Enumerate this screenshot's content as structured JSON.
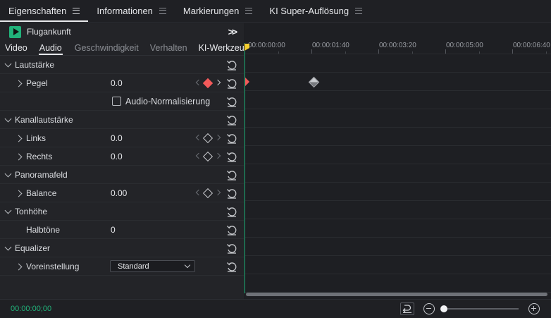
{
  "top_tabs": [
    {
      "label": "Eigenschaften",
      "active": true
    },
    {
      "label": "Informationen",
      "active": false
    },
    {
      "label": "Markierungen",
      "active": false
    },
    {
      "label": "KI Super-Auflösung",
      "active": false
    }
  ],
  "clip": {
    "name": "Flugankunft",
    "badge_color": "#21b27a"
  },
  "sub_tabs": [
    {
      "label": "Video",
      "state": "on"
    },
    {
      "label": "Audio",
      "state": "selected"
    },
    {
      "label": "Geschwindigkeit",
      "state": "off"
    },
    {
      "label": "Verhalten",
      "state": "off"
    },
    {
      "label": "KI-Werkzeuge",
      "state": "on"
    }
  ],
  "properties": {
    "lautstaerke": {
      "label": "Lautstärke"
    },
    "pegel": {
      "label": "Pegel",
      "value": "0.0"
    },
    "normalisierung": {
      "label": "Audio-Normalisierung",
      "checked": false
    },
    "kanallautstaerke": {
      "label": "Kanallautstärke"
    },
    "links": {
      "label": "Links",
      "value": "0.0"
    },
    "rechts": {
      "label": "Rechts",
      "value": "0.0"
    },
    "panoramafeld": {
      "label": "Panoramafeld"
    },
    "balance": {
      "label": "Balance",
      "value": "0.00"
    },
    "tonhoehe": {
      "label": "Tonhöhe"
    },
    "halbtoene": {
      "label": "Halbtöne",
      "value": "0"
    },
    "equalizer": {
      "label": "Equalizer"
    },
    "voreinstellung": {
      "label": "Voreinstellung",
      "value": "Standard"
    }
  },
  "timeline": {
    "ticks": [
      "00:00:00:00",
      "00:00:01:40",
      "00:00:03:20",
      "00:00:05:00",
      "00:00:06:40"
    ],
    "playhead_color": "#21b27a",
    "keyframe_active_color": "#f35a5a"
  },
  "bottom": {
    "timecode": "00:00:00;00"
  },
  "colors": {
    "accent": "#21b27a",
    "playhead_marker": "#f4cf2f"
  }
}
